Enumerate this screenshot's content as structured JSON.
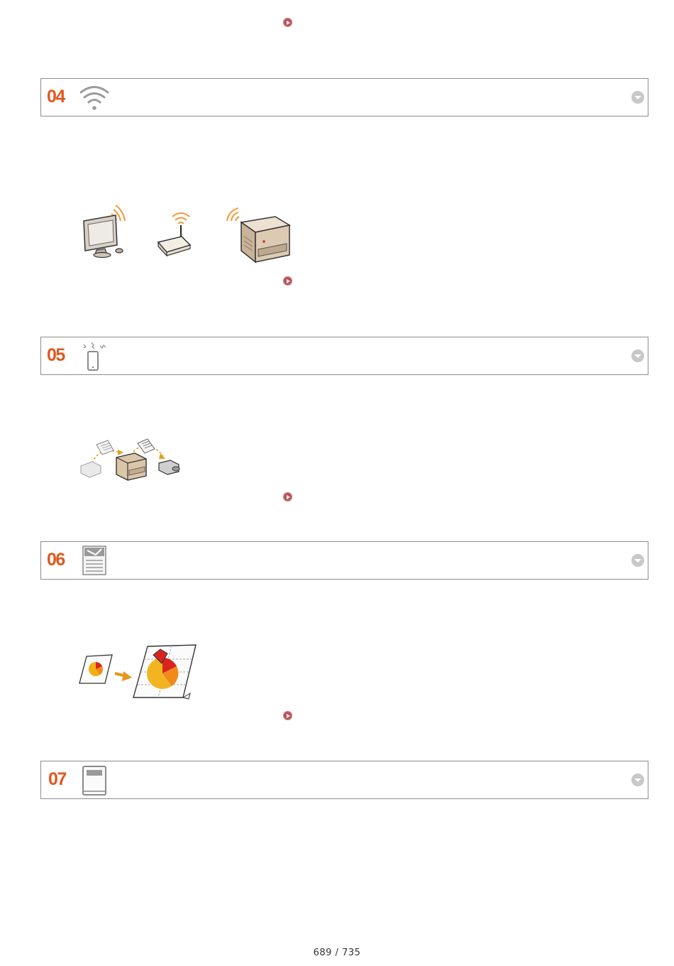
{
  "sections": [
    {
      "number": "04",
      "icon": "wifi-icon"
    },
    {
      "number": "05",
      "icon": "mobile-device-icon"
    },
    {
      "number": "06",
      "icon": "poster-print-icon"
    },
    {
      "number": "07",
      "icon": "document-icon"
    }
  ],
  "footer": {
    "page_number": "689 / 735"
  },
  "colors": {
    "accent": "#e2571d",
    "link_arrow": "#b8555a",
    "border": "#8c8c8c"
  }
}
